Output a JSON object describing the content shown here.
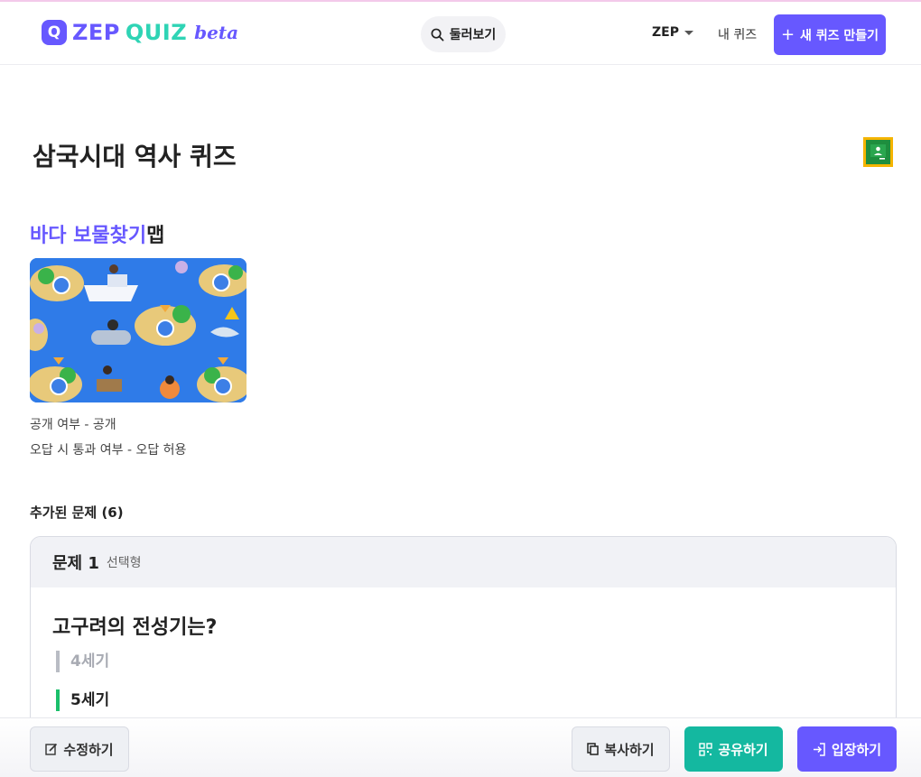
{
  "header": {
    "logo_q": "Q",
    "logo_zep": "ZEP",
    "logo_quiz": "QUIZ",
    "logo_beta": "beta",
    "search_label": "둘러보기",
    "zep_menu": "ZEP",
    "my_quiz": "내 퀴즈",
    "new_quiz": "새 퀴즈 만들기"
  },
  "quiz": {
    "title": "삼국시대 역사 퀴즈",
    "map_accent": "바다 보물찾기",
    "map_suffix": "맵",
    "visibility": "공개 여부 - 공개",
    "wrong_answer_pass": "오답 시 통과 여부 - 오답 허용",
    "added_label": "추가된 문제 (6)"
  },
  "question": {
    "number": "문제 1",
    "type": "선택형",
    "text": "고구려의 전성기는?",
    "options": [
      "4세기",
      "5세기"
    ]
  },
  "actions": {
    "edit": "수정하기",
    "copy": "복사하기",
    "share": "공유하기",
    "enter": "입장하기"
  },
  "colors": {
    "brand": "#6758ff",
    "accent_teal": "#14b8a0",
    "correct": "#1bbf6b"
  }
}
